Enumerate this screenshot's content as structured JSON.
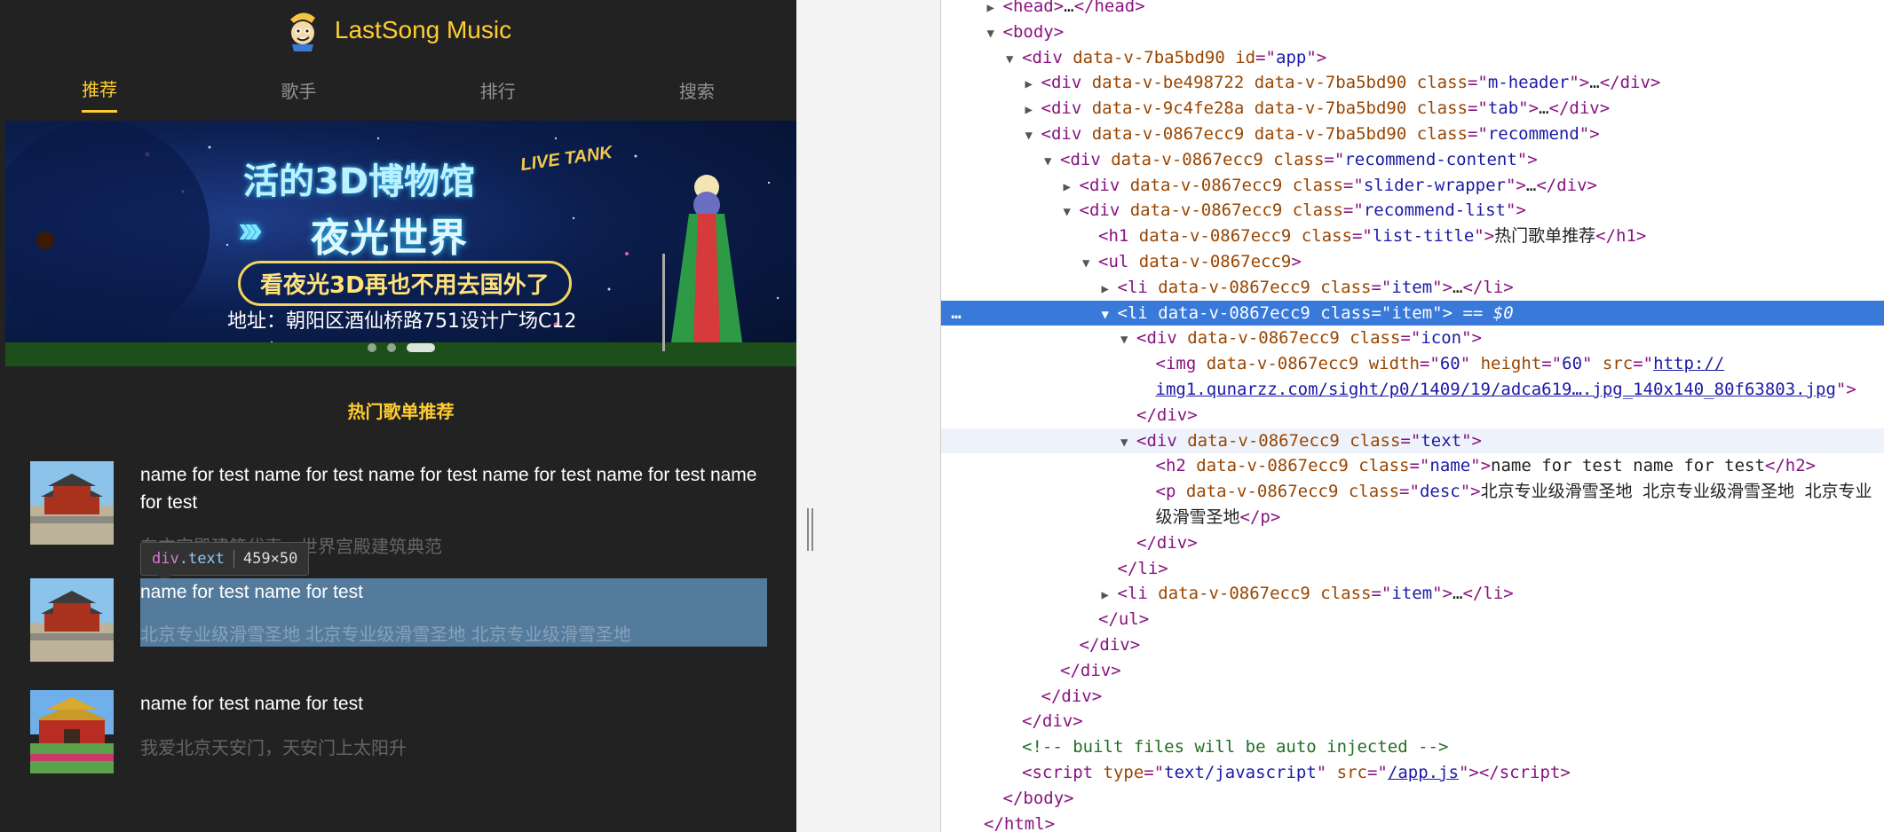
{
  "app": {
    "title": "LastSong Music",
    "tabs": [
      {
        "label": "推荐",
        "active": true
      },
      {
        "label": "歌手",
        "active": false
      },
      {
        "label": "排行",
        "active": false
      },
      {
        "label": "搜索",
        "active": false
      }
    ],
    "slider": {
      "line1": "活的3D博物馆",
      "arrows": "›››",
      "line2": "夜光世界",
      "banner": "看夜光3D再也不用去国外了",
      "address": "地址：朝阳区酒仙桥路751设计广场C12",
      "badge": "LIVE TANK",
      "active_dot": 3,
      "dot_count": 3
    },
    "list_title": "热门歌单推荐",
    "items": [
      {
        "name": "name for test name for test name for test name for test name for test name for test",
        "desc": "东方宫殿建筑代表，世界宫殿建筑典范"
      },
      {
        "name": "name for test name for test",
        "desc": "北京专业级滑雪圣地 北京专业级滑雪圣地 北京专业级滑雪圣地"
      },
      {
        "name": "name for test name for test",
        "desc": "我爱北京天安门，天安门上太阳升"
      }
    ],
    "inspect_tooltip": {
      "tag": "div",
      "cls": ".text",
      "size": "459×50"
    }
  },
  "devtools": {
    "lines": [
      {
        "i": 0,
        "tri": "▶",
        "html": [
          [
            "t",
            "<head>"
          ],
          [
            "tx",
            "…"
          ],
          [
            "t",
            "</head>"
          ]
        ]
      },
      {
        "i": 0,
        "tri": "▼",
        "html": [
          [
            "t",
            "<body>"
          ]
        ]
      },
      {
        "i": 1,
        "tri": "▼",
        "html": [
          [
            "t",
            "<div "
          ],
          [
            "a",
            "data-v-7ba5bd90 id"
          ],
          [
            "t",
            "=\""
          ],
          [
            "v",
            "app"
          ],
          [
            "t",
            "\">"
          ]
        ]
      },
      {
        "i": 2,
        "tri": "▶",
        "html": [
          [
            "t",
            "<div "
          ],
          [
            "a",
            "data-v-be498722 data-v-7ba5bd90 class"
          ],
          [
            "t",
            "=\""
          ],
          [
            "v",
            "m-header"
          ],
          [
            "t",
            "\">"
          ],
          [
            "tx",
            "…"
          ],
          [
            "t",
            "</div>"
          ]
        ]
      },
      {
        "i": 2,
        "tri": "▶",
        "html": [
          [
            "t",
            "<div "
          ],
          [
            "a",
            "data-v-9c4fe28a data-v-7ba5bd90 class"
          ],
          [
            "t",
            "=\""
          ],
          [
            "v",
            "tab"
          ],
          [
            "t",
            "\">"
          ],
          [
            "tx",
            "…"
          ],
          [
            "t",
            "</div>"
          ]
        ]
      },
      {
        "i": 2,
        "tri": "▼",
        "html": [
          [
            "t",
            "<div "
          ],
          [
            "a",
            "data-v-0867ecc9 data-v-7ba5bd90 class"
          ],
          [
            "t",
            "=\""
          ],
          [
            "v",
            "recommend"
          ],
          [
            "t",
            "\">"
          ]
        ]
      },
      {
        "i": 3,
        "tri": "▼",
        "html": [
          [
            "t",
            "<div "
          ],
          [
            "a",
            "data-v-0867ecc9 class"
          ],
          [
            "t",
            "=\""
          ],
          [
            "v",
            "recommend-content"
          ],
          [
            "t",
            "\">"
          ]
        ]
      },
      {
        "i": 4,
        "tri": "▶",
        "html": [
          [
            "t",
            "<div "
          ],
          [
            "a",
            "data-v-0867ecc9 class"
          ],
          [
            "t",
            "=\""
          ],
          [
            "v",
            "slider-wrapper"
          ],
          [
            "t",
            "\">"
          ],
          [
            "tx",
            "…"
          ],
          [
            "t",
            "</div>"
          ]
        ]
      },
      {
        "i": 4,
        "tri": "▼",
        "html": [
          [
            "t",
            "<div "
          ],
          [
            "a",
            "data-v-0867ecc9 class"
          ],
          [
            "t",
            "=\""
          ],
          [
            "v",
            "recommend-list"
          ],
          [
            "t",
            "\">"
          ]
        ]
      },
      {
        "i": 5,
        "tri": "",
        "html": [
          [
            "t",
            "<h1 "
          ],
          [
            "a",
            "data-v-0867ecc9 class"
          ],
          [
            "t",
            "=\""
          ],
          [
            "v",
            "list-title"
          ],
          [
            "t",
            "\">"
          ],
          [
            "tx",
            "热门歌单推荐"
          ],
          [
            "t",
            "</h1>"
          ]
        ]
      },
      {
        "i": 5,
        "tri": "▼",
        "html": [
          [
            "t",
            "<ul "
          ],
          [
            "a",
            "data-v-0867ecc9"
          ],
          [
            "t",
            ">"
          ]
        ]
      },
      {
        "i": 6,
        "tri": "▶",
        "html": [
          [
            "t",
            "<li "
          ],
          [
            "a",
            "data-v-0867ecc9 class"
          ],
          [
            "t",
            "=\""
          ],
          [
            "v",
            "item"
          ],
          [
            "t",
            "\">"
          ],
          [
            "tx",
            "…"
          ],
          [
            "t",
            "</li>"
          ]
        ]
      },
      {
        "i": 6,
        "tri": "▼",
        "selected": true,
        "html": [
          [
            "t",
            "<li "
          ],
          [
            "a",
            "data-v-0867ecc9 class"
          ],
          [
            "t",
            "=\""
          ],
          [
            "v",
            "item"
          ],
          [
            "t",
            "\">"
          ],
          [
            "dim",
            " == $0"
          ]
        ]
      },
      {
        "i": 7,
        "tri": "▼",
        "html": [
          [
            "t",
            "<div "
          ],
          [
            "a",
            "data-v-0867ecc9 class"
          ],
          [
            "t",
            "=\""
          ],
          [
            "v",
            "icon"
          ],
          [
            "t",
            "\">"
          ]
        ]
      },
      {
        "i": 8,
        "tri": "",
        "html": [
          [
            "t",
            "<img "
          ],
          [
            "a",
            "data-v-0867ecc9 width"
          ],
          [
            "t",
            "=\""
          ],
          [
            "v",
            "60"
          ],
          [
            "t",
            "\" "
          ],
          [
            "a",
            "height"
          ],
          [
            "t",
            "=\""
          ],
          [
            "v",
            "60"
          ],
          [
            "t",
            "\" "
          ],
          [
            "a",
            "src"
          ],
          [
            "t",
            "=\""
          ],
          [
            "lnk",
            "http://"
          ]
        ]
      },
      {
        "i": 8,
        "tri": "",
        "html": [
          [
            "lnk",
            "img1.qunarzz.com/sight/p0/1409/19/adca619….jpg_140x140_80f63803.jpg"
          ],
          [
            "t",
            "\">"
          ]
        ]
      },
      {
        "i": 7,
        "tri": "",
        "html": [
          [
            "t",
            "</div>"
          ]
        ]
      },
      {
        "i": 7,
        "tri": "▼",
        "hover": true,
        "html": [
          [
            "t",
            "<div "
          ],
          [
            "a",
            "data-v-0867ecc9 class"
          ],
          [
            "t",
            "=\""
          ],
          [
            "v",
            "text"
          ],
          [
            "t",
            "\">"
          ]
        ]
      },
      {
        "i": 8,
        "tri": "",
        "html": [
          [
            "t",
            "<h2 "
          ],
          [
            "a",
            "data-v-0867ecc9 class"
          ],
          [
            "t",
            "=\""
          ],
          [
            "v",
            "name"
          ],
          [
            "t",
            "\">"
          ],
          [
            "tx",
            "name for test name for test"
          ],
          [
            "t",
            "</h2>"
          ]
        ]
      },
      {
        "i": 8,
        "tri": "",
        "html": [
          [
            "t",
            "<p "
          ],
          [
            "a",
            "data-v-0867ecc9 class"
          ],
          [
            "t",
            "=\""
          ],
          [
            "v",
            "desc"
          ],
          [
            "t",
            "\">"
          ],
          [
            "tx",
            "北京专业级滑雪圣地 北京专业级滑雪圣地 北京专业"
          ]
        ]
      },
      {
        "i": 8,
        "tri": "",
        "html": [
          [
            "tx",
            "级滑雪圣地"
          ],
          [
            "t",
            "</p>"
          ]
        ]
      },
      {
        "i": 7,
        "tri": "",
        "html": [
          [
            "t",
            "</div>"
          ]
        ]
      },
      {
        "i": 6,
        "tri": "",
        "html": [
          [
            "t",
            "</li>"
          ]
        ]
      },
      {
        "i": 6,
        "tri": "▶",
        "html": [
          [
            "t",
            "<li "
          ],
          [
            "a",
            "data-v-0867ecc9 class"
          ],
          [
            "t",
            "=\""
          ],
          [
            "v",
            "item"
          ],
          [
            "t",
            "\">"
          ],
          [
            "tx",
            "…"
          ],
          [
            "t",
            "</li>"
          ]
        ]
      },
      {
        "i": 5,
        "tri": "",
        "html": [
          [
            "t",
            "</ul>"
          ]
        ]
      },
      {
        "i": 4,
        "tri": "",
        "html": [
          [
            "t",
            "</div>"
          ]
        ]
      },
      {
        "i": 3,
        "tri": "",
        "html": [
          [
            "t",
            "</div>"
          ]
        ]
      },
      {
        "i": 2,
        "tri": "",
        "html": [
          [
            "t",
            "</div>"
          ]
        ]
      },
      {
        "i": 1,
        "tri": "",
        "html": [
          [
            "t",
            "</div>"
          ]
        ]
      },
      {
        "i": 1,
        "tri": "",
        "html": [
          [
            "cm",
            "<!-- built files will be auto injected -->"
          ]
        ]
      },
      {
        "i": 1,
        "tri": "",
        "html": [
          [
            "t",
            "<script "
          ],
          [
            "a",
            "type"
          ],
          [
            "t",
            "=\""
          ],
          [
            "v",
            "text/javascript"
          ],
          [
            "t",
            "\" "
          ],
          [
            "a",
            "src"
          ],
          [
            "t",
            "=\""
          ],
          [
            "lnk",
            "/app.js"
          ],
          [
            "t",
            "\"></"
          ],
          [
            "t",
            "script>"
          ]
        ]
      },
      {
        "i": 0,
        "tri": "",
        "html": [
          [
            "t",
            "</body>"
          ]
        ]
      },
      {
        "i": -1,
        "tri": "",
        "html": [
          [
            "t",
            "</html>"
          ]
        ]
      }
    ],
    "ellipsis": "…"
  }
}
